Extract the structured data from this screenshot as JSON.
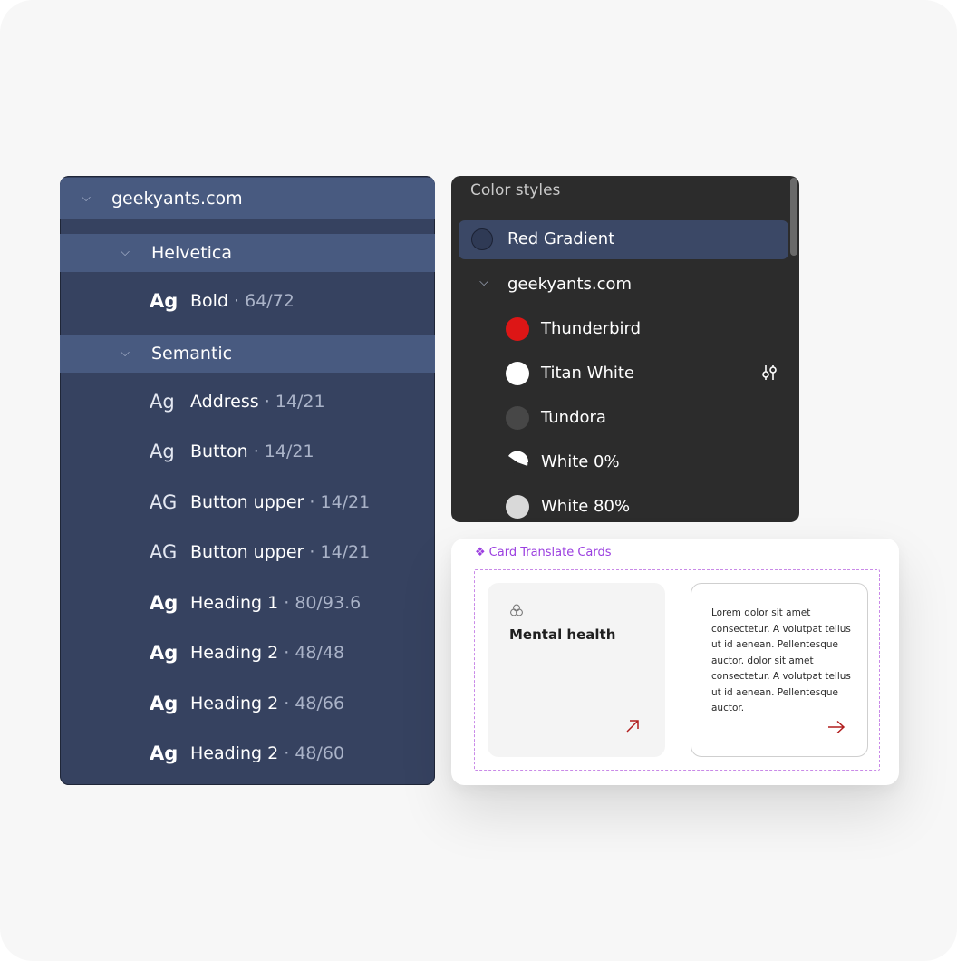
{
  "text_styles": {
    "root": {
      "label": "geekyants.com"
    },
    "groups": [
      {
        "label": "Helvetica"
      },
      {
        "label": "Semantic"
      }
    ],
    "styles": [
      {
        "ag": "Ag",
        "name": "Bold",
        "meta": " · 64/72"
      },
      {
        "ag": "Ag",
        "name": "Address",
        "meta": " · 14/21"
      },
      {
        "ag": "Ag",
        "name": "Button",
        "meta": " · 14/21"
      },
      {
        "ag": "AG",
        "name": "Button upper",
        "meta": " · 14/21"
      },
      {
        "ag": "AG",
        "name": "Button upper",
        "meta": " · 14/21"
      },
      {
        "ag": "Ag",
        "name": "Heading 1",
        "meta": " · 80/93.6"
      },
      {
        "ag": "Ag",
        "name": "Heading 2",
        "meta": " · 48/48"
      },
      {
        "ag": "Ag",
        "name": "Heading 2",
        "meta": " · 48/66"
      },
      {
        "ag": "Ag",
        "name": "Heading 2",
        "meta": " · 48/60"
      }
    ]
  },
  "color_styles": {
    "title": "Color styles",
    "selected": {
      "label": "Red Gradient",
      "color": "#3b4866"
    },
    "group": {
      "label": "geekyants.com"
    },
    "colors": [
      {
        "label": "Thunderbird",
        "color": "#dd1616"
      },
      {
        "label": "Titan White",
        "color": "#ffffff"
      },
      {
        "label": "Tundora",
        "color": "#474747"
      },
      {
        "label": "White 0%",
        "color": "#ffffff"
      },
      {
        "label": "White 80%",
        "color": "#d9d9d9"
      }
    ],
    "adjust_icon": "adjust-sliders-icon"
  },
  "component": {
    "label": "Card Translate Cards",
    "accent": "#9b3fe0",
    "card_a": {
      "title": "Mental health",
      "arrow_color": "#b11d1d"
    },
    "card_b": {
      "body": "Lorem dolor sit amet consectetur. A volutpat tellus ut id aenean. Pellentesque auctor. dolor sit amet consectetur. A volutpat tellus ut id aenean. Pellentesque auctor.",
      "arrow_color": "#b11d1d"
    }
  }
}
